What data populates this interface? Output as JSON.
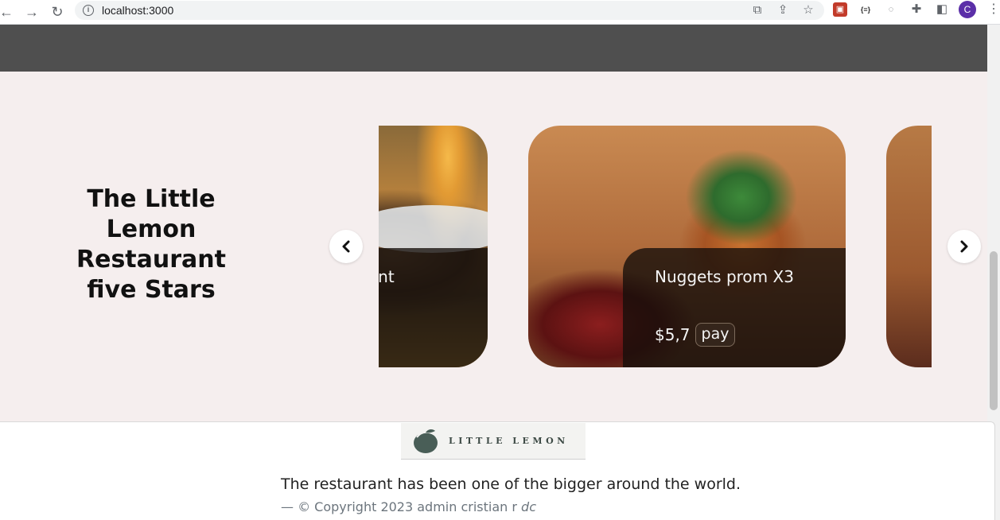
{
  "browser": {
    "url": "localhost:3000",
    "avatar_initial": "C",
    "ext_json_label": "{≡}"
  },
  "hero": {
    "title": "The Little Lemon Restaurant five Stars"
  },
  "carousel": {
    "cards": [
      {
        "title": "e moment",
        "price": "",
        "pay_label": ""
      },
      {
        "title": "Nuggets prom X3",
        "price": "$5,7",
        "pay_label": "pay"
      },
      {
        "title": "",
        "price": "",
        "pay_label": ""
      }
    ]
  },
  "footer": {
    "logo_text": "LITTLE LEMON",
    "description": "The restaurant has been one of the bigger around the world.",
    "copyright_prefix": "— © Copyright 2023 admin cristian r",
    "copyright_suffix": "dc"
  },
  "colors": {
    "header_band": "#4f4f4f",
    "hero_bg": "#f5eeee",
    "avatar": "#5b2fa8"
  }
}
